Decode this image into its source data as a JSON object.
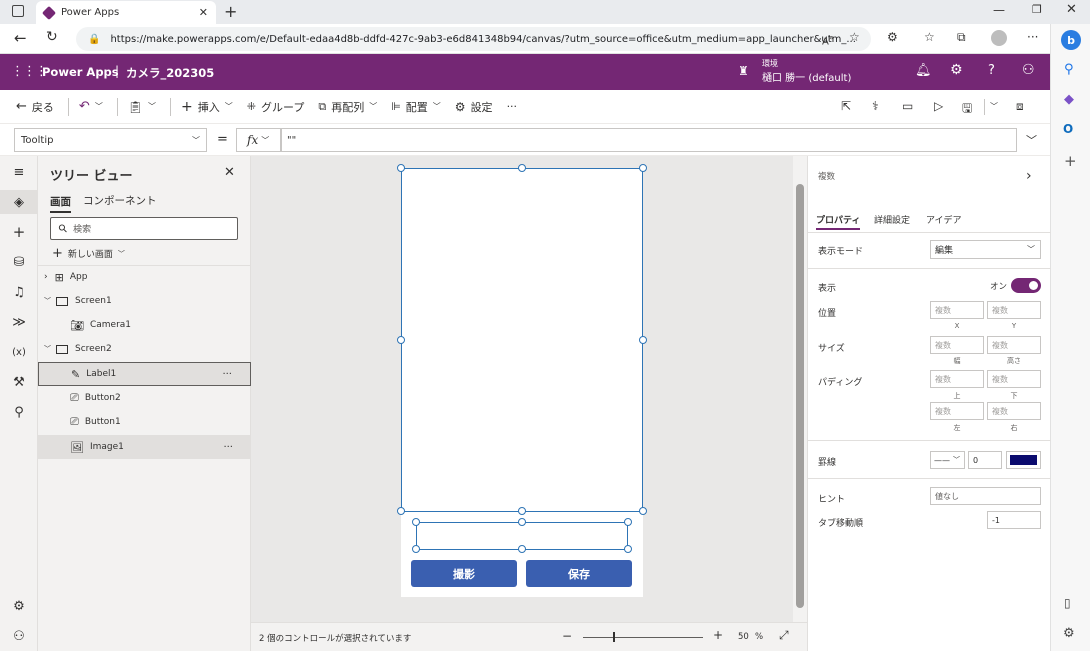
{
  "browser": {
    "tab_title": "Power Apps",
    "url": "https://make.powerapps.com/e/Default-edaa4d8b-ddfd-427c-9ab3-e6d841348b94/canvas/?utm_source=office&utm_medium=app_launcher&utm_..."
  },
  "header": {
    "app_name": "Power Apps",
    "separator": "|",
    "file_name": "カメラ_202305",
    "env_label": "環境",
    "env_name": "樋口 勝一 (default)"
  },
  "cmdbar": {
    "back": "戻る",
    "insert": "挿入",
    "group": "グループ",
    "reorder": "再配列",
    "align": "配置",
    "settings": "設定",
    "more": "···"
  },
  "formula": {
    "property": "Tooltip",
    "equals": "=",
    "fx": "fx",
    "value": "\"\""
  },
  "tree": {
    "title": "ツリー ビュー",
    "tab_screens": "画面",
    "tab_components": "コンポーネント",
    "search_placeholder": "検索",
    "new_screen": "新しい画面",
    "items": [
      {
        "label": "App"
      },
      {
        "label": "Screen1"
      },
      {
        "label": "Camera1"
      },
      {
        "label": "Screen2"
      },
      {
        "label": "Label1"
      },
      {
        "label": "Button2"
      },
      {
        "label": "Button1"
      },
      {
        "label": "Image1"
      }
    ],
    "more": "···"
  },
  "canvas": {
    "btn_capture": "撮影",
    "btn_save": "保存",
    "status": "2 個のコントロールが選択されています",
    "zoom_minus": "−",
    "zoom_plus": "+",
    "zoom_value": "50",
    "zoom_unit": "%",
    "zoom_level": 0.5
  },
  "props": {
    "title": "複数",
    "tab_properties": "プロパティ",
    "tab_advanced": "詳細設定",
    "tab_ideas": "アイデア",
    "display_mode_label": "表示モード",
    "display_mode_value": "編集",
    "visible_label": "表示",
    "visible_value": "オン",
    "position_label": "位置",
    "size_label": "サイズ",
    "padding_label": "パディング",
    "multi": "複数",
    "x": "X",
    "y": "Y",
    "width": "幅",
    "height": "高さ",
    "top": "上",
    "bottom": "下",
    "left": "左",
    "right": "右",
    "border_label": "罫線",
    "border_width": "0",
    "border_color": "#0b0b6e",
    "hint_label": "ヒント",
    "hint_value": "値なし",
    "tab_index_label": "タブ移動順",
    "tab_index_value": "-1"
  },
  "colors": {
    "brand": "#742774",
    "button": "#3a5fb0",
    "selection": "#2e74b5",
    "toggle": "#742774"
  }
}
